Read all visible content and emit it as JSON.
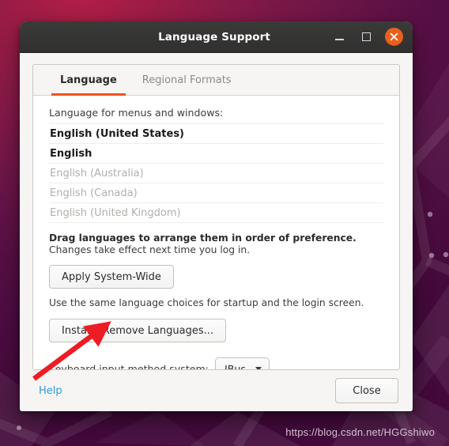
{
  "window": {
    "title": "Language Support",
    "controls": {
      "minimize_label": "Minimize",
      "maximize_label": "Maximize",
      "close_label": "Close"
    }
  },
  "tabs": [
    {
      "label": "Language",
      "active": true
    },
    {
      "label": "Regional Formats",
      "active": false
    }
  ],
  "main": {
    "list_label": "Language for menus and windows:",
    "languages": [
      {
        "name": "English (United States)",
        "installed": true
      },
      {
        "name": "English",
        "installed": true
      },
      {
        "name": "English (Australia)",
        "installed": false
      },
      {
        "name": "English (Canada)",
        "installed": false
      },
      {
        "name": "English (United Kingdom)",
        "installed": false
      }
    ],
    "drag_hint": "Drag languages to arrange them in order of preference.",
    "changes_hint": "Changes take effect next time you log in.",
    "apply_button": "Apply System-Wide",
    "apply_note": "Use the same language choices for startup and the login screen.",
    "install_button": "Install / Remove Languages...",
    "keyboard_label": "Keyboard input method system:",
    "keyboard_value": "IBus"
  },
  "actions": {
    "help_label": "Help",
    "close_label": "Close"
  },
  "watermark": "https://blog.csdn.net/HGGshiwo",
  "colors": {
    "accent": "#e95420",
    "titlebar": "#333333",
    "link": "#2e9ad0",
    "annotation_arrow": "#ee1c25",
    "window_background": "#f6f5f4",
    "content_background": "#ffffff"
  }
}
